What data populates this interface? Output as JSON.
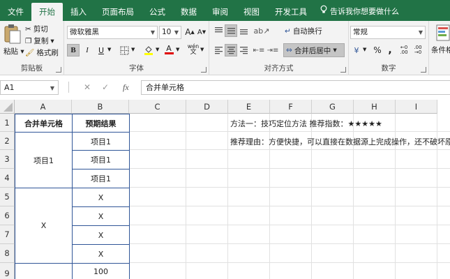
{
  "ribbon_tabs": [
    "文件",
    "开始",
    "插入",
    "页面布局",
    "公式",
    "数据",
    "审阅",
    "视图",
    "开发工具"
  ],
  "active_tab": "开始",
  "tell_me": "告诉我你想要做什么",
  "clipboard": {
    "paste": "粘贴",
    "cut": "剪切",
    "copy": "复制",
    "format_painter": "格式刷",
    "label": "剪贴板"
  },
  "font": {
    "name": "微软雅黑",
    "size": "10",
    "bold": "B",
    "italic": "I",
    "underline": "U",
    "grow": "A",
    "shrink": "A",
    "font_color": "A",
    "phonetic": "wén",
    "label": "字体"
  },
  "alignment": {
    "wrap": "自动换行",
    "merge": "合并后居中",
    "label": "对齐方式"
  },
  "number": {
    "format": "常规",
    "currency": "¥",
    "percent": "%",
    "comma": ",",
    "label": "数字"
  },
  "styles": {
    "conditional": "条件格"
  },
  "formula_bar": {
    "name_box": "A1",
    "fx": "fx",
    "content": "合并单元格"
  },
  "columns": [
    "A",
    "B",
    "C",
    "D",
    "E",
    "F",
    "G",
    "H",
    "I"
  ],
  "rows": [
    "1",
    "2",
    "3",
    "4",
    "5",
    "6",
    "7",
    "8",
    "9"
  ],
  "table": {
    "header_a": "合并单元格",
    "header_b": "预期结果",
    "group1": "项目1",
    "group2": "X",
    "b_values": [
      "项目1",
      "项目1",
      "项目1",
      "X",
      "X",
      "X",
      "X",
      "100"
    ]
  },
  "notes": {
    "line1": "方法一：技巧定位方法    推荐指数：★★★★★",
    "line2": "推荐理由：方便快捷，可以直接在数据源上完成操作，还不破坏原表"
  }
}
